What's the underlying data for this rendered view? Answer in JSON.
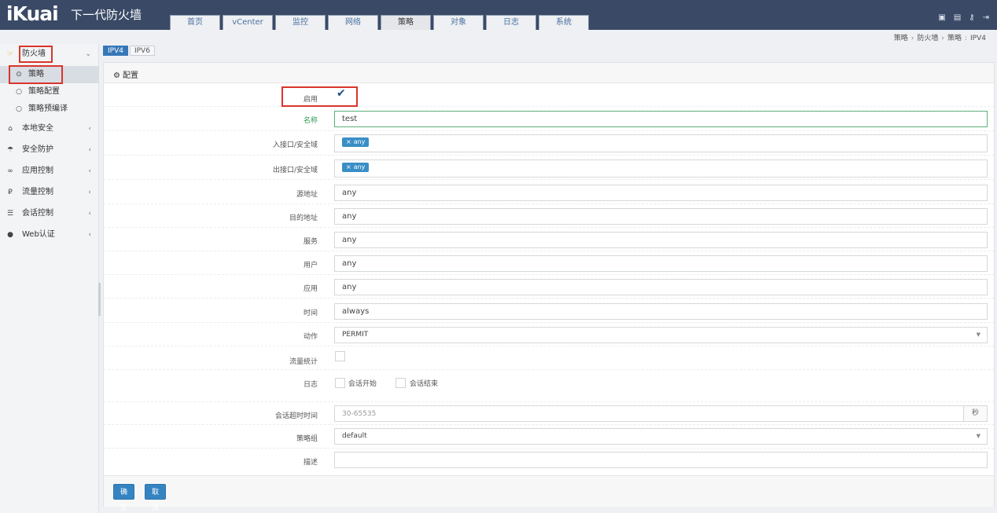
{
  "header": {
    "logo": "iKuai",
    "product": "下一代防火墙",
    "tabs": [
      "首页",
      "vCenter",
      "监控",
      "网络",
      "策略",
      "对象",
      "日志",
      "系统"
    ],
    "active_tab": "策略"
  },
  "breadcrumb": {
    "items": [
      "策略",
      "防火墙",
      "策略"
    ],
    "tail": "IPV4",
    "seps": [
      "›",
      "›",
      ":"
    ]
  },
  "sidebar": {
    "firewall": "防火墙",
    "sub_items": [
      "策略",
      "策略配置",
      "策略预编译"
    ],
    "sections": [
      "本地安全",
      "安全防护",
      "应用控制",
      "流量控制",
      "会话控制",
      "Web认证"
    ]
  },
  "subtabs": [
    "IPV4",
    "IPV6"
  ],
  "panel": {
    "title": "配置"
  },
  "form": {
    "enable_label": "启用",
    "name_label": "名称",
    "name_value": "test",
    "in_if_label": "入接口/安全域",
    "in_if_tag": "any",
    "out_if_label": "出接口/安全域",
    "out_if_tag": "any",
    "src_label": "源地址",
    "src_value": "any",
    "dst_label": "目的地址",
    "dst_value": "any",
    "service_label": "服务",
    "service_value": "any",
    "user_label": "用户",
    "user_value": "any",
    "app_label": "应用",
    "app_value": "any",
    "time_label": "时间",
    "time_value": "always",
    "action_label": "动作",
    "action_value": "PERMIT",
    "stats_label": "流量统计",
    "log_label": "日志",
    "log_start": "会话开始",
    "log_end": "会话结束",
    "timeout_label": "会话超时时间",
    "timeout_placeholder": "30-65535",
    "timeout_unit": "秒",
    "group_label": "策略组",
    "group_value": "default",
    "desc_label": "描述"
  },
  "buttons": {
    "ok": "确定",
    "cancel": "取消"
  }
}
